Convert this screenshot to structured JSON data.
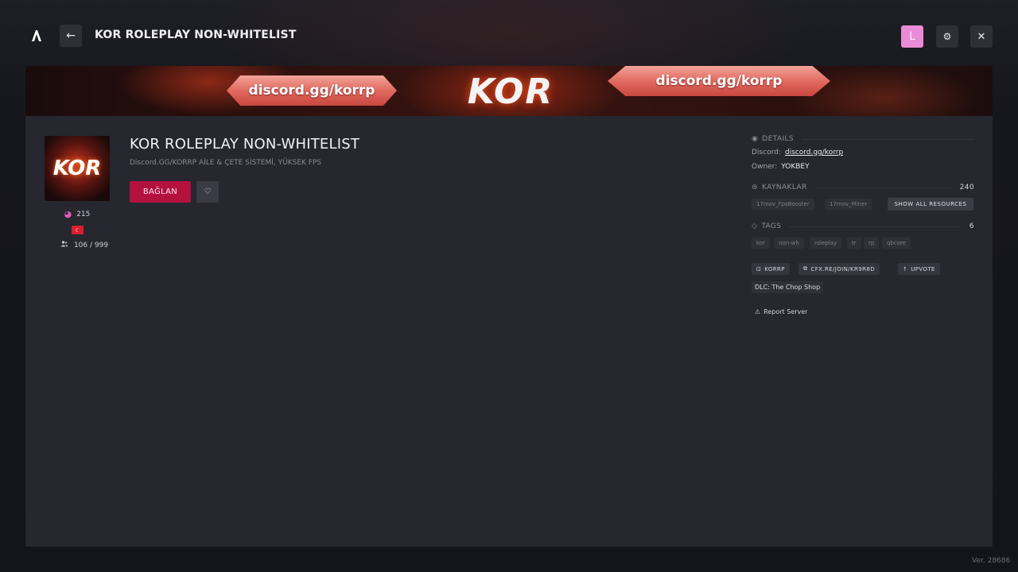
{
  "header": {
    "title": "KOR ROLEPLAY NON-WHITELIST",
    "back_label": "←",
    "avatar_letter": "L",
    "settings_glyph": "⚙",
    "close_glyph": "✕",
    "logo_icon": "redm-logo-icon",
    "colors": {
      "avatar_bg": "#e98bd6",
      "button_bg": "#2e2f37"
    }
  },
  "banner": {
    "left_text": "discord.gg/korrp",
    "center_logo": "KOR",
    "right_text": "discord.gg/korrp"
  },
  "server": {
    "icon_text": "KOR",
    "boosts": "215",
    "players": "106 / 999",
    "title": "KOR ROLEPLAY NON-WHITELIST",
    "subtitle": "Discord.GG/KORRP AİLE & ÇETE SİSTEMİ, YÜKSEK FPS",
    "connect_label": "BAĞLAN",
    "favorite_glyph": "♡",
    "colors": {
      "connect_bg": "#b3123f",
      "boost_icon": "#e25bb8",
      "flag": "#d81e2c"
    }
  },
  "details": {
    "heading": "DETAILS",
    "discord_label": "Discord:",
    "discord_value": "discord.gg/korrp",
    "owner_label": "Owner:",
    "owner_value": "YOKBEY"
  },
  "resources": {
    "heading": "KAYNAKLAR",
    "count": "240",
    "items": [
      "17mov_FpsBooster",
      "17mov_Miner"
    ],
    "show_all_label": "SHOW ALL RESOURCES"
  },
  "tags": {
    "heading": "TAGS",
    "count": "6",
    "items": [
      "kor",
      "non-wh",
      "roleplay",
      "tr",
      "rp",
      "qbcore"
    ]
  },
  "actions": {
    "korrp_label": "KORRP",
    "join_label": "CFX.RE/JOIN/KR9R8D",
    "upvote_label": "UPVOTE"
  },
  "dlc_label": "DLC: The Chop Shop",
  "report_label": "Report Server",
  "version": "Ver. 28686"
}
